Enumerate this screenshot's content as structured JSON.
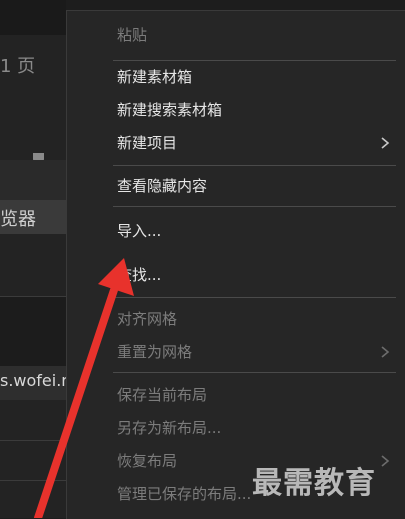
{
  "background_panel": {
    "top_label": "1 页",
    "side_label": "览器",
    "url_fragment": "s.wofei.n"
  },
  "menu": {
    "items": [
      {
        "label": "粘贴",
        "enabled": false,
        "submenu": false
      },
      {
        "label": "新建素材箱",
        "enabled": true,
        "submenu": false
      },
      {
        "label": "新建搜索素材箱",
        "enabled": true,
        "submenu": false
      },
      {
        "label": "新建项目",
        "enabled": true,
        "submenu": true
      },
      {
        "label": "查看隐藏内容",
        "enabled": true,
        "submenu": false
      },
      {
        "label": "导入...",
        "enabled": true,
        "submenu": false
      },
      {
        "label": "查找...",
        "enabled": true,
        "submenu": false
      },
      {
        "label": "对齐网格",
        "enabled": false,
        "submenu": false
      },
      {
        "label": "重置为网格",
        "enabled": false,
        "submenu": true
      },
      {
        "label": "保存当前布局",
        "enabled": false,
        "submenu": false
      },
      {
        "label": "另存为新布局...",
        "enabled": false,
        "submenu": false
      },
      {
        "label": "恢复布局",
        "enabled": false,
        "submenu": true
      },
      {
        "label": "管理已保存的布局...",
        "enabled": false,
        "submenu": false
      }
    ]
  },
  "annotation": {
    "arrow_color": "#e8322c"
  },
  "watermark": {
    "text": "最需教育"
  },
  "colors": {
    "menu_bg": "#262626",
    "text_enabled": "#e6e6e6",
    "text_disabled": "#7c7c7c"
  }
}
